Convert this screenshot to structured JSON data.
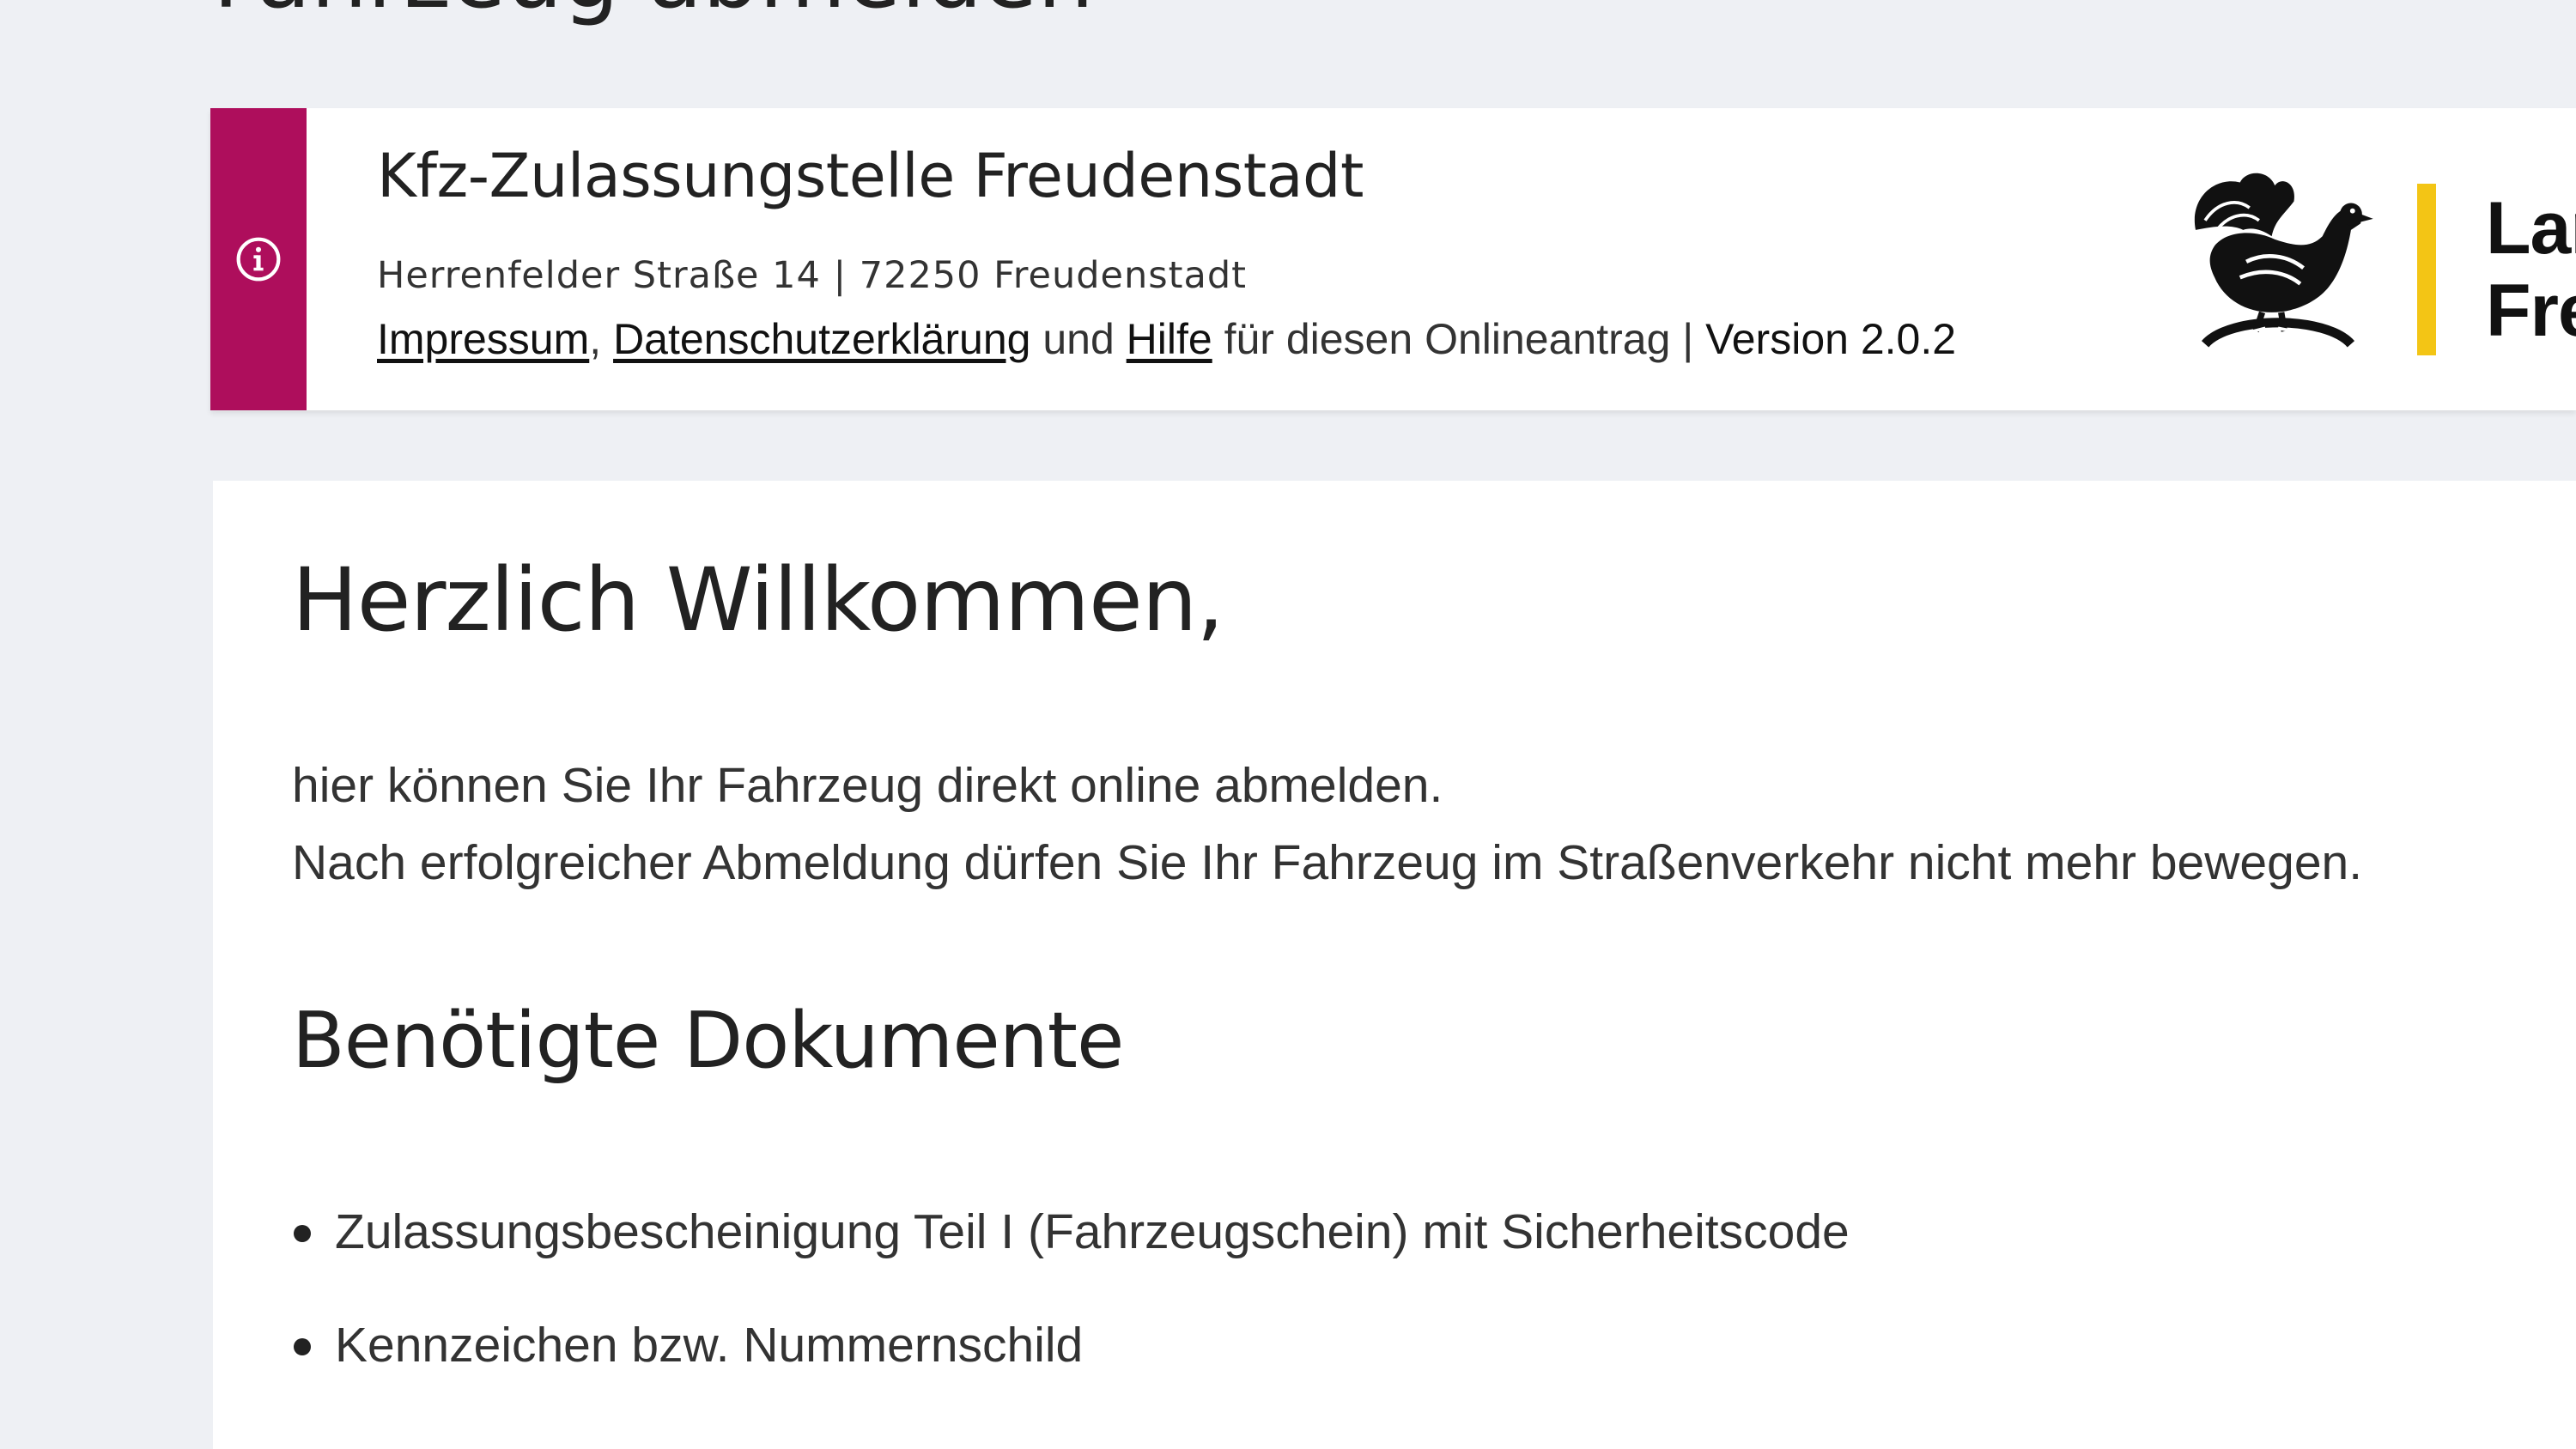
{
  "page": {
    "title": "Fahrzeug abmelden"
  },
  "banner": {
    "icon": "info-icon",
    "office_name": "Kfz-Zulassungstelle Freudenstadt",
    "address": "Herrenfelder Straße 14 | 72250 Freudenstadt",
    "links": {
      "impressum": "Impressum",
      "sep1": ", ",
      "datenschutz": "Datenschutzerklärung",
      "sep2": " und ",
      "hilfe": "Hilfe",
      "suffix": " für diesen Onlineantrag | ",
      "version": "Version 2.0.2"
    },
    "logo": {
      "line1": "Landkr",
      "line2": "Freude",
      "accent_color": "#f3c515"
    },
    "stripe_color": "#ae0e5c"
  },
  "main": {
    "welcome": "Herzlich Willkommen,",
    "intro_lines": [
      "hier können Sie Ihr Fahrzeug direkt online abmelden.",
      "Nach erfolgreicher Abmeldung dürfen Sie Ihr Fahrzeug im Straßenverkehr nicht mehr bewegen."
    ],
    "documents_heading": "Benötigte Dokumente",
    "documents": [
      "Zulassungsbescheinigung Teil I (Fahrzeugschein) mit Sicherheitscode",
      "Kennzeichen bzw. Nummernschild"
    ]
  }
}
